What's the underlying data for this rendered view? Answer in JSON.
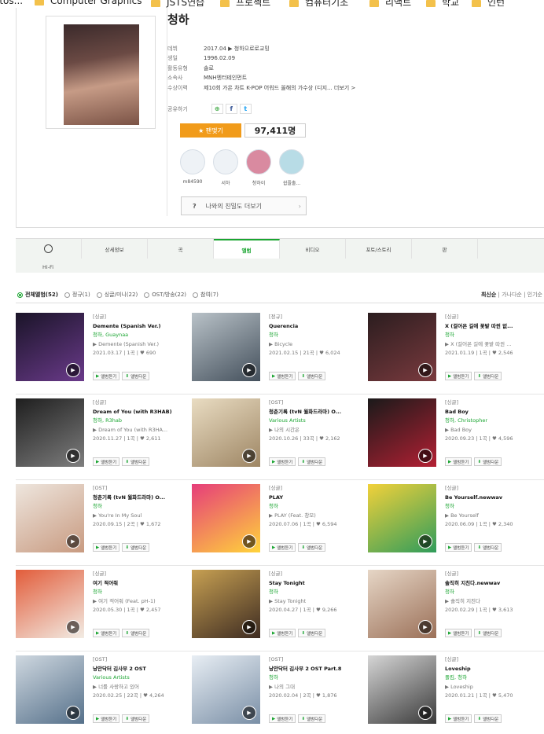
{
  "bookmarks": [
    {
      "label": "otos...",
      "folder": false
    },
    {
      "label": "Computer Graphics",
      "folder": true
    },
    {
      "label": "JSTS연습",
      "folder": true
    },
    {
      "label": "프로젝트",
      "folder": true
    },
    {
      "label": "컴퓨터기초",
      "folder": true
    },
    {
      "label": "리액트",
      "folder": true
    },
    {
      "label": "학교",
      "folder": true
    },
    {
      "label": "인턴",
      "folder": true
    }
  ],
  "artist": {
    "name": "청하",
    "info": [
      {
        "label": "데뷔",
        "value": "2017.04  ▶ 청하으로로교밍"
      },
      {
        "label": "생일",
        "value": "1996.02.09"
      },
      {
        "label": "활동유형",
        "value": "솔로"
      },
      {
        "label": "소속사",
        "value": "MNH엔터테인먼트"
      },
      {
        "label": "수상이력",
        "value": "제10회 가온 차트 K-POP 어워드  올해의 가수상 (디지...  더보기 >"
      }
    ],
    "share_label": "공유하기",
    "fan_button": "★ 팬맺기",
    "fan_count": "97,411명",
    "fans": [
      {
        "name": "m84590"
      },
      {
        "name": "서하"
      },
      {
        "name": "청하이"
      },
      {
        "name": "쉽플출..."
      }
    ],
    "closeness_label": "나와의 친밀도 더보기"
  },
  "tabs": [
    {
      "label": "",
      "icon": "clock-icon"
    },
    {
      "label": "상세정보"
    },
    {
      "label": "곡"
    },
    {
      "label": "앨범",
      "active": true
    },
    {
      "label": "비디오"
    },
    {
      "label": "포토/스토리"
    },
    {
      "label": "판"
    }
  ],
  "hifi": "Hi-Fi",
  "filters": [
    {
      "label": "전체앨범(52)",
      "active": true
    },
    {
      "label": "정규(1)"
    },
    {
      "label": "싱글/미니(22)"
    },
    {
      "label": "OST/방송(22)"
    },
    {
      "label": "참여(7)"
    }
  ],
  "sorts": {
    "s1": "최신순",
    "sep": " | ",
    "s2": "가나다순",
    "s3": "인기순"
  },
  "buttons": {
    "listen": "앨범듣기",
    "download": "앨범다운"
  },
  "albums": [
    {
      "type": "[싱글]",
      "name": "Demente (Spanish Ver.)",
      "artist": "청하, Guaynaa",
      "song": "▶ Demente (Spanish Ver.)",
      "info": "2021.03.17  | 1곡  | ♥ 690",
      "c1": "#1a1428",
      "c2": "#6a3a8a"
    },
    {
      "type": "[정규]",
      "name": "Querencia",
      "artist": "청하",
      "song": "▶ Bicycle",
      "info": "2021.02.15  | 21곡  | ♥ 6,024",
      "c1": "#b9c2c8",
      "c2": "#44505c"
    },
    {
      "type": "[싱글]",
      "name": "X (걸어온 길에 꽃밭 따윈 없...",
      "artist": "청하",
      "song": "▶ X (걸어온 길에 꽃밭 따윈 ...",
      "info": "2021.01.19  | 1곡  | ♥ 2,546",
      "c1": "#2b1d1f",
      "c2": "#7a3a3e"
    },
    {
      "type": "[싱글]",
      "name": "Dream of You (with R3HAB)",
      "artist": "청하, R3hab",
      "song": "▶ Dream of You (with R3HA...",
      "info": "2020.11.27  | 1곡  | ♥ 2,611",
      "c1": "#1e1e1e",
      "c2": "#7e7e7e"
    },
    {
      "type": "[OST]",
      "name": "청춘기록 (tvN 월화드라마) O...",
      "artist": "Various Artists",
      "song": "▶ 나의 시간은",
      "info": "2020.10.26  | 33곡  | ♥ 2,162",
      "c1": "#e9dcc2",
      "c2": "#9e8664"
    },
    {
      "type": "[싱글]",
      "name": "Bad Boy",
      "artist": "청하, Christopher",
      "song": "▶ Bad Boy",
      "info": "2020.09.23  | 1곡  | ♥ 4,596",
      "c1": "#1a1a1a",
      "c2": "#b32033"
    },
    {
      "type": "[OST]",
      "name": "청춘기록 (tvN 월화드라마) O...",
      "artist": "청하",
      "song": "▶ You're In My Soul",
      "info": "2020.09.15  | 2곡  | ♥ 1,672",
      "c1": "#eee6de",
      "c2": "#c89a80"
    },
    {
      "type": "[싱글]",
      "name": "PLAY",
      "artist": "청하",
      "song": "▶ PLAY (Feat. 창모)",
      "info": "2020.07.06  | 1곡  | ♥ 6,594",
      "c1": "#e63d7a",
      "c2": "#ffd43b"
    },
    {
      "type": "[싱글]",
      "name": "Be Yourself.newwav",
      "artist": "청하",
      "song": "▶ Be Yourself",
      "info": "2020.06.09  | 1곡  | ♥ 2,340",
      "c1": "#f2d13a",
      "c2": "#2f9c5b"
    },
    {
      "type": "[싱글]",
      "name": "여기 적어줘",
      "artist": "청하",
      "song": "▶ 여기 적어줘 (Feat. pH-1)",
      "info": "2020.05.30  | 1곡  | ♥ 2,457",
      "c1": "#e25c3a",
      "c2": "#f2ece4"
    },
    {
      "type": "[싱글]",
      "name": "Stay Tonight",
      "artist": "청하",
      "song": "▶ Stay Tonight",
      "info": "2020.04.27  | 1곡  | ♥ 9,266",
      "c1": "#c7a052",
      "c2": "#3e2c22"
    },
    {
      "type": "[싱글]",
      "name": "솔직히 지친다.newwav",
      "artist": "청하",
      "song": "▶ 솔직히 지친다",
      "info": "2020.02.29  | 1곡  | ♥ 3,613",
      "c1": "#e6d6c6",
      "c2": "#9b7058"
    },
    {
      "type": "[OST]",
      "name": "낭만닥터 김사부 2 OST",
      "artist": "Various Artists",
      "song": "▶ 너를 사랑하고 있어",
      "info": "2020.02.25  | 22곡  | ♥ 4,264",
      "c1": "#cfd8e0",
      "c2": "#55708a"
    },
    {
      "type": "[OST]",
      "name": "낭만닥터 김사부 2 OST Part.8",
      "artist": "청하",
      "song": "▶ 나의 그대",
      "info": "2020.02.04  | 2곡  | ♥ 1,876",
      "c1": "#e8eef4",
      "c2": "#7a8fa6"
    },
    {
      "type": "[싱글]",
      "name": "Loveship",
      "artist": "폴킴, 청하",
      "song": "▶ Loveship",
      "info": "2020.01.21  | 1곡  | ♥ 5,470",
      "c1": "#d6d6d6",
      "c2": "#3a3a3a"
    }
  ]
}
